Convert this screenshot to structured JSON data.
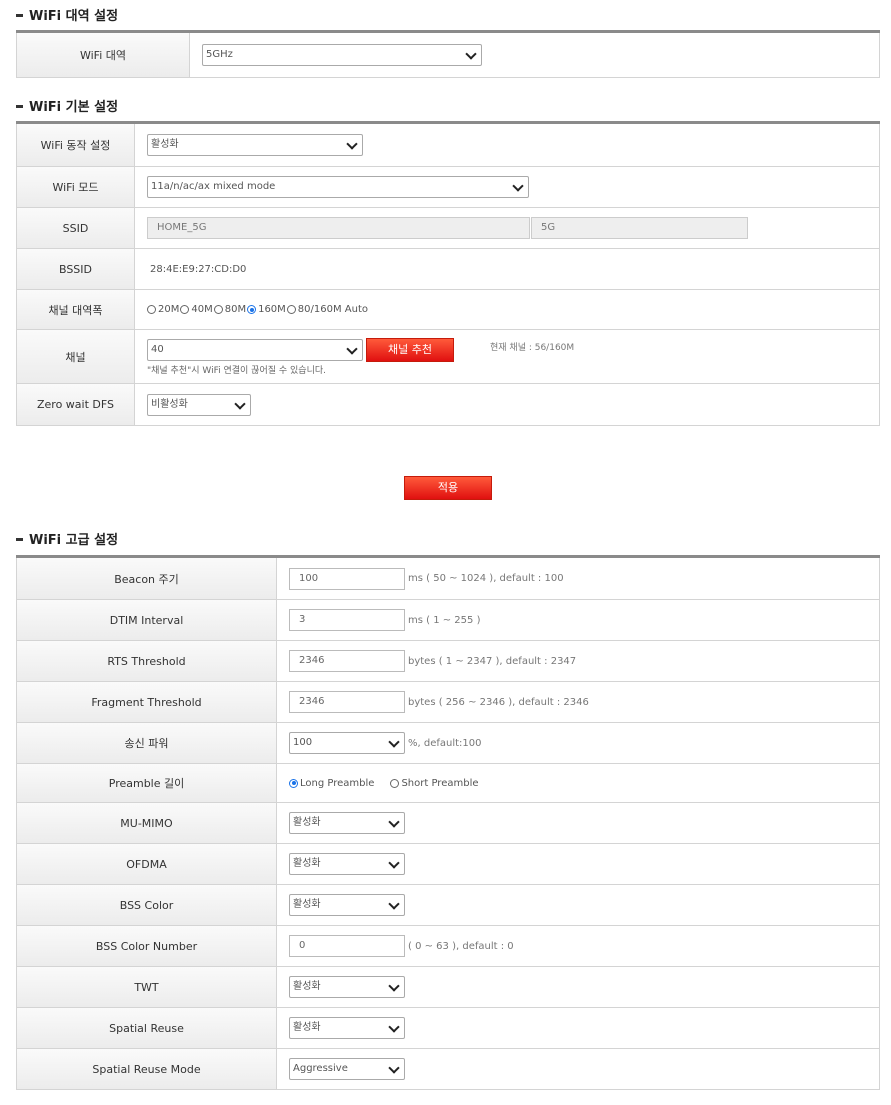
{
  "band_section": {
    "title": "WiFi 대역 설정",
    "band_label": "WiFi 대역",
    "band_value": "5GHz"
  },
  "basic_section": {
    "title": "WiFi 기본 설정",
    "operation_label": "WiFi 동작 설정",
    "operation_value": "활성화",
    "mode_label": "WiFi 모드",
    "mode_value": "11a/n/ac/ax mixed mode",
    "ssid_label": "SSID",
    "ssid_value": "HOME_5G",
    "ssid_suffix": "5G",
    "bssid_label": "BSSID",
    "bssid_value": "28:4E:E9:27:CD:D0",
    "bandwidth_label": "채널 대역폭",
    "bandwidth_options": [
      "20M",
      "40M",
      "80M",
      "160M",
      "80/160M Auto"
    ],
    "bandwidth_selected": "160M",
    "channel_label": "채널",
    "channel_value": "40",
    "channel_recommend_button": "채널 추천",
    "current_channel": "현재 채널 : 56/160M",
    "channel_note": "\"채널 추천\"시 WiFi 연결이 끊어질 수 있습니다.",
    "zero_wait_label": "Zero wait DFS",
    "zero_wait_value": "비활성화"
  },
  "apply_button": "적용",
  "advanced_section": {
    "title": "WiFi 고급 설정",
    "beacon_label": "Beacon 주기",
    "beacon_value": "100",
    "beacon_hint": "ms ( 50 ~ 1024 ), default : 100",
    "dtim_label": "DTIM Interval",
    "dtim_value": "3",
    "dtim_hint": "ms ( 1 ~ 255 )",
    "rts_label": "RTS Threshold",
    "rts_value": "2346",
    "rts_hint": "bytes ( 1 ~ 2347 ), default : 2347",
    "frag_label": "Fragment Threshold",
    "frag_value": "2346",
    "frag_hint": "bytes ( 256 ~ 2346 ), default : 2346",
    "power_label": "송신 파워",
    "power_value": "100",
    "power_hint": "%, default:100",
    "preamble_label": "Preamble 길이",
    "preamble_long": "Long Preamble",
    "preamble_short": "Short Preamble",
    "preamble_selected": "Long Preamble",
    "mumimo_label": "MU-MIMO",
    "mumimo_value": "활성화",
    "ofdma_label": "OFDMA",
    "ofdma_value": "활성화",
    "bsscolor_label": "BSS Color",
    "bsscolor_value": "활성화",
    "bsscolornum_label": "BSS Color Number",
    "bsscolornum_value": "0",
    "bsscolornum_hint": "( 0 ~ 63 ), default : 0",
    "twt_label": "TWT",
    "twt_value": "활성화",
    "sr_label": "Spatial Reuse",
    "sr_value": "활성화",
    "srmode_label": "Spatial Reuse Mode",
    "srmode_value": "Aggressive"
  },
  "colors": {
    "accent_red": "#e8200e",
    "radio_blue": "#1a73e8",
    "table_rule": "#8a8a8a"
  }
}
